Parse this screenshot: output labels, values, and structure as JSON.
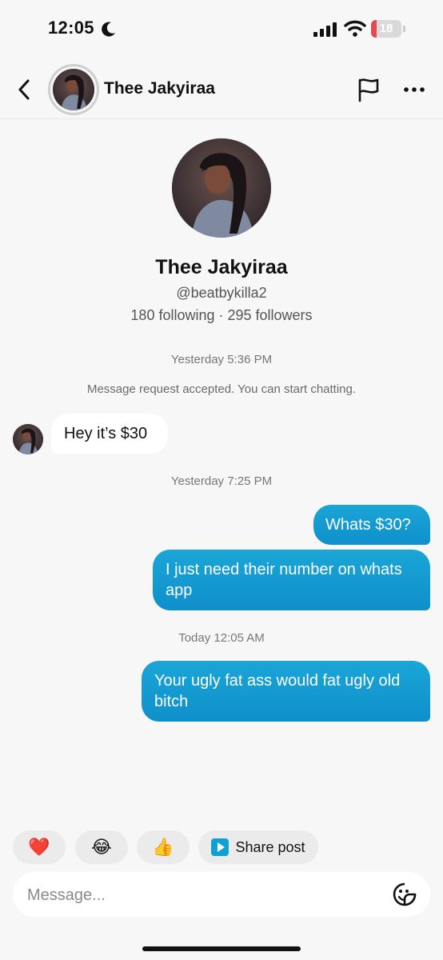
{
  "status_bar": {
    "time": "12:05",
    "battery": "18",
    "battery_level_percent": 18
  },
  "header": {
    "name": "Thee Jakyiraa"
  },
  "profile": {
    "name": "Thee Jakyiraa",
    "handle": "@beatbykilla2",
    "stats": "180 following · 295 followers"
  },
  "conversation": {
    "timestamp_1": "Yesterday 5:36 PM",
    "system_message": "Message request accepted. You can start chatting.",
    "incoming_1": "Hey it’s $30",
    "timestamp_2": "Yesterday 7:25 PM",
    "outgoing_1": "Whats $30?",
    "outgoing_2": "I just need their number on whats app",
    "timestamp_3": "Today 12:05 AM",
    "outgoing_3": "Your ugly fat ass would fat ugly old bitch"
  },
  "quick_reactions": {
    "heart": "❤️",
    "laugh": "😂",
    "thumbs_up": "👍",
    "share_label": "Share post"
  },
  "composer": {
    "placeholder": "Message..."
  },
  "colors": {
    "accent": "#0f8fcb",
    "background": "#f7f7f7",
    "battery_low": "#e5484d"
  },
  "icons": [
    "moon-icon",
    "cellular-signal-icon",
    "wifi-icon",
    "battery-icon",
    "back-chevron-icon",
    "flag-icon",
    "more-icon",
    "play-icon",
    "sticker-icon"
  ]
}
